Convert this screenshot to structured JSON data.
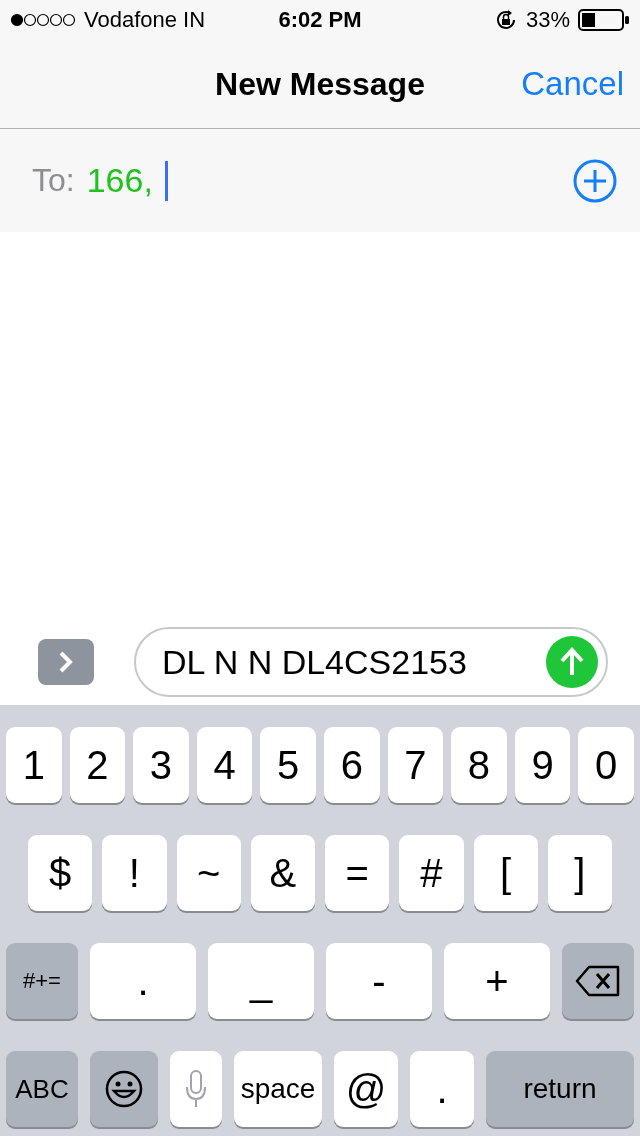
{
  "status_bar": {
    "carrier": "Vodafone IN",
    "time": "6:02 PM",
    "battery": "33%"
  },
  "nav": {
    "title": "New Message",
    "cancel": "Cancel"
  },
  "to_field": {
    "label": "To:",
    "recipient": "166,"
  },
  "composer": {
    "value": "DL N N DL4CS2153"
  },
  "keyboard": [
    [
      {
        "kind": "char",
        "label": "1"
      },
      {
        "kind": "char",
        "label": "2"
      },
      {
        "kind": "char",
        "label": "3"
      },
      {
        "kind": "char",
        "label": "4"
      },
      {
        "kind": "char",
        "label": "5"
      },
      {
        "kind": "char",
        "label": "6"
      },
      {
        "kind": "char",
        "label": "7"
      },
      {
        "kind": "char",
        "label": "8"
      },
      {
        "kind": "char",
        "label": "9"
      },
      {
        "kind": "char",
        "label": "0"
      }
    ],
    [
      {
        "kind": "char",
        "label": "$"
      },
      {
        "kind": "char",
        "label": "!"
      },
      {
        "kind": "char",
        "label": "~"
      },
      {
        "kind": "char",
        "label": "&"
      },
      {
        "kind": "char",
        "label": "="
      },
      {
        "kind": "char",
        "label": "#"
      },
      {
        "kind": "char",
        "label": "["
      },
      {
        "kind": "char",
        "label": "]"
      }
    ],
    [
      {
        "kind": "mode",
        "label": "#+="
      },
      {
        "kind": "char",
        "label": "."
      },
      {
        "kind": "char",
        "label": "_"
      },
      {
        "kind": "char",
        "label": "-"
      },
      {
        "kind": "char",
        "label": "+"
      },
      {
        "kind": "delete"
      }
    ],
    [
      {
        "kind": "mode",
        "label": "ABC"
      },
      {
        "kind": "emoji"
      },
      {
        "kind": "mic"
      },
      {
        "kind": "space",
        "label": "space"
      },
      {
        "kind": "char",
        "label": "@"
      },
      {
        "kind": "char",
        "label": "."
      },
      {
        "kind": "return",
        "label": "return"
      }
    ]
  ]
}
